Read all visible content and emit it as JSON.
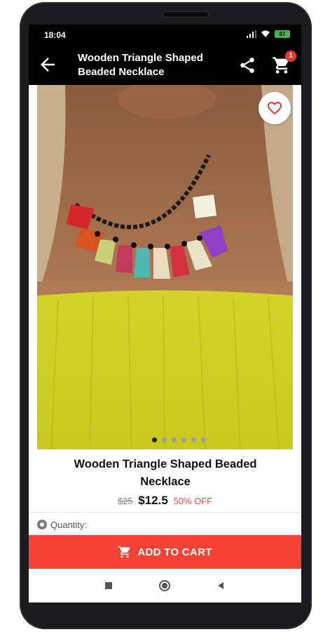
{
  "status": {
    "time": "18:04",
    "battery": "87"
  },
  "appbar": {
    "title": "Wooden Triangle Shaped Beaded Necklace",
    "cart_count": "1"
  },
  "product": {
    "title": "Wooden Triangle Shaped Beaded Necklace",
    "price_old": "$25",
    "price_new": "$12.5",
    "discount": "50% OFF",
    "image_slides": 6,
    "active_slide": 1
  },
  "quantity": {
    "label": "Quantity:"
  },
  "cart_button": {
    "label": "ADD TO CART"
  },
  "icons": {
    "back": "arrow-left-icon",
    "share": "share-icon",
    "cart": "cart-icon",
    "favorite": "heart-outline-icon",
    "quantity": "radio-icon",
    "nav_recents": "square-icon",
    "nav_home": "circle-icon",
    "nav_back": "triangle-icon"
  },
  "colors": {
    "accent": "#f44336",
    "appbar": "#000000",
    "badge": "#e53935",
    "discount": "#ef5350"
  }
}
